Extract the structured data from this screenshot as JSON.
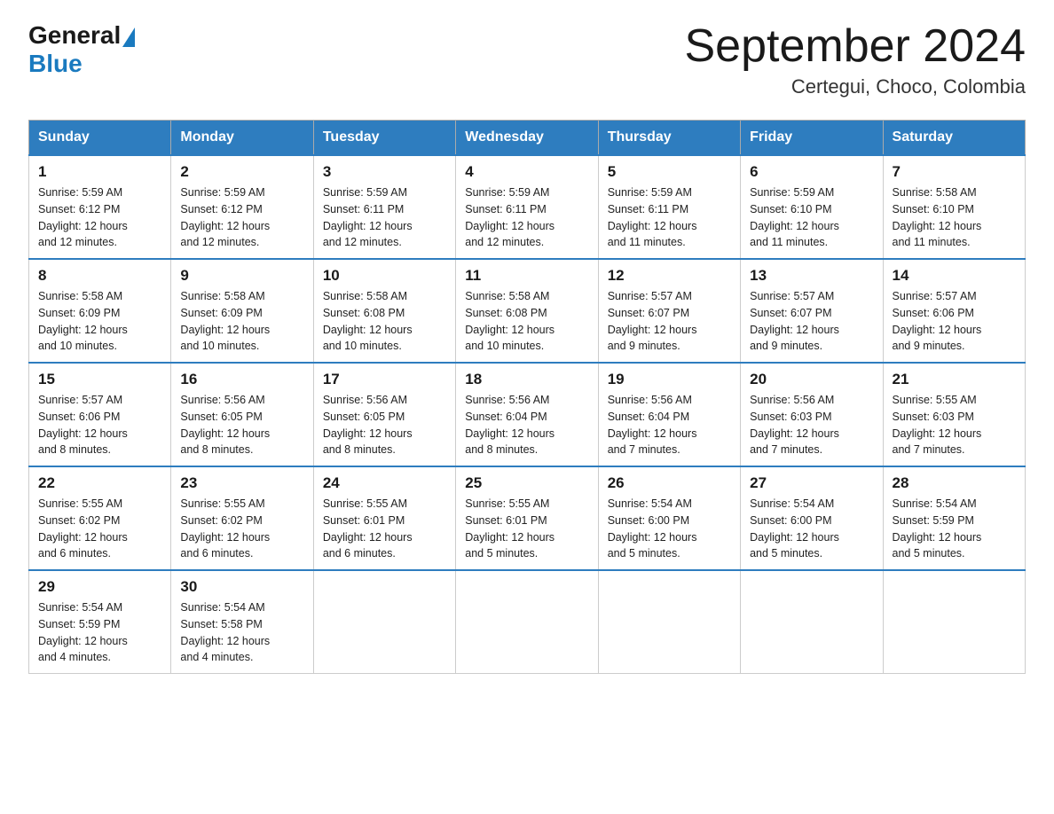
{
  "header": {
    "logo_general": "General",
    "logo_blue": "Blue",
    "title": "September 2024",
    "subtitle": "Certegui, Choco, Colombia"
  },
  "days_of_week": [
    "Sunday",
    "Monday",
    "Tuesday",
    "Wednesday",
    "Thursday",
    "Friday",
    "Saturday"
  ],
  "weeks": [
    [
      {
        "day": "1",
        "sunrise": "5:59 AM",
        "sunset": "6:12 PM",
        "daylight": "12 hours and 12 minutes."
      },
      {
        "day": "2",
        "sunrise": "5:59 AM",
        "sunset": "6:12 PM",
        "daylight": "12 hours and 12 minutes."
      },
      {
        "day": "3",
        "sunrise": "5:59 AM",
        "sunset": "6:11 PM",
        "daylight": "12 hours and 12 minutes."
      },
      {
        "day": "4",
        "sunrise": "5:59 AM",
        "sunset": "6:11 PM",
        "daylight": "12 hours and 12 minutes."
      },
      {
        "day": "5",
        "sunrise": "5:59 AM",
        "sunset": "6:11 PM",
        "daylight": "12 hours and 11 minutes."
      },
      {
        "day": "6",
        "sunrise": "5:59 AM",
        "sunset": "6:10 PM",
        "daylight": "12 hours and 11 minutes."
      },
      {
        "day": "7",
        "sunrise": "5:58 AM",
        "sunset": "6:10 PM",
        "daylight": "12 hours and 11 minutes."
      }
    ],
    [
      {
        "day": "8",
        "sunrise": "5:58 AM",
        "sunset": "6:09 PM",
        "daylight": "12 hours and 10 minutes."
      },
      {
        "day": "9",
        "sunrise": "5:58 AM",
        "sunset": "6:09 PM",
        "daylight": "12 hours and 10 minutes."
      },
      {
        "day": "10",
        "sunrise": "5:58 AM",
        "sunset": "6:08 PM",
        "daylight": "12 hours and 10 minutes."
      },
      {
        "day": "11",
        "sunrise": "5:58 AM",
        "sunset": "6:08 PM",
        "daylight": "12 hours and 10 minutes."
      },
      {
        "day": "12",
        "sunrise": "5:57 AM",
        "sunset": "6:07 PM",
        "daylight": "12 hours and 9 minutes."
      },
      {
        "day": "13",
        "sunrise": "5:57 AM",
        "sunset": "6:07 PM",
        "daylight": "12 hours and 9 minutes."
      },
      {
        "day": "14",
        "sunrise": "5:57 AM",
        "sunset": "6:06 PM",
        "daylight": "12 hours and 9 minutes."
      }
    ],
    [
      {
        "day": "15",
        "sunrise": "5:57 AM",
        "sunset": "6:06 PM",
        "daylight": "12 hours and 8 minutes."
      },
      {
        "day": "16",
        "sunrise": "5:56 AM",
        "sunset": "6:05 PM",
        "daylight": "12 hours and 8 minutes."
      },
      {
        "day": "17",
        "sunrise": "5:56 AM",
        "sunset": "6:05 PM",
        "daylight": "12 hours and 8 minutes."
      },
      {
        "day": "18",
        "sunrise": "5:56 AM",
        "sunset": "6:04 PM",
        "daylight": "12 hours and 8 minutes."
      },
      {
        "day": "19",
        "sunrise": "5:56 AM",
        "sunset": "6:04 PM",
        "daylight": "12 hours and 7 minutes."
      },
      {
        "day": "20",
        "sunrise": "5:56 AM",
        "sunset": "6:03 PM",
        "daylight": "12 hours and 7 minutes."
      },
      {
        "day": "21",
        "sunrise": "5:55 AM",
        "sunset": "6:03 PM",
        "daylight": "12 hours and 7 minutes."
      }
    ],
    [
      {
        "day": "22",
        "sunrise": "5:55 AM",
        "sunset": "6:02 PM",
        "daylight": "12 hours and 6 minutes."
      },
      {
        "day": "23",
        "sunrise": "5:55 AM",
        "sunset": "6:02 PM",
        "daylight": "12 hours and 6 minutes."
      },
      {
        "day": "24",
        "sunrise": "5:55 AM",
        "sunset": "6:01 PM",
        "daylight": "12 hours and 6 minutes."
      },
      {
        "day": "25",
        "sunrise": "5:55 AM",
        "sunset": "6:01 PM",
        "daylight": "12 hours and 5 minutes."
      },
      {
        "day": "26",
        "sunrise": "5:54 AM",
        "sunset": "6:00 PM",
        "daylight": "12 hours and 5 minutes."
      },
      {
        "day": "27",
        "sunrise": "5:54 AM",
        "sunset": "6:00 PM",
        "daylight": "12 hours and 5 minutes."
      },
      {
        "day": "28",
        "sunrise": "5:54 AM",
        "sunset": "5:59 PM",
        "daylight": "12 hours and 5 minutes."
      }
    ],
    [
      {
        "day": "29",
        "sunrise": "5:54 AM",
        "sunset": "5:59 PM",
        "daylight": "12 hours and 4 minutes."
      },
      {
        "day": "30",
        "sunrise": "5:54 AM",
        "sunset": "5:58 PM",
        "daylight": "12 hours and 4 minutes."
      },
      null,
      null,
      null,
      null,
      null
    ]
  ],
  "labels": {
    "sunrise": "Sunrise:",
    "sunset": "Sunset:",
    "daylight": "Daylight:"
  }
}
